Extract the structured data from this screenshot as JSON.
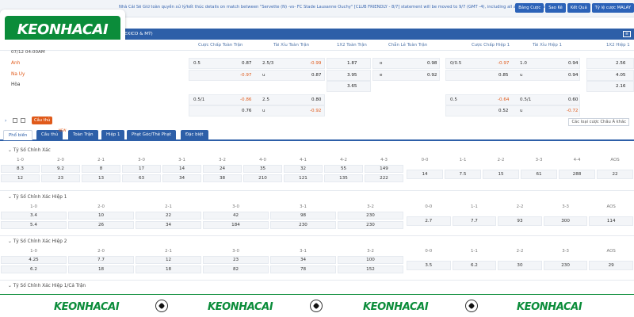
{
  "notice": "Nhà Cái Sẽ Giữ toàn quyền xử lý/kết thúc details on match between \"Servette (N) -vs- FC Stade Lausanne Ouchy\" [CLUB FRIENDLY - 8/7] statement will be moved to 9/7 (GMT -4), including all affected special product.",
  "top_buttons": [
    "Bảng Cược",
    "Sao Kê",
    "Kết Quả",
    "Tỷ lệ cược MALAY"
  ],
  "logo_text": "KEONHACAI",
  "league_name": "(MEXICO & MỸ)",
  "headers": {
    "h1": "Cược Chấp Toàn Trận",
    "h2": "Tài Xỉu Toàn Trận",
    "h3": "1X2 Toàn Trận",
    "h4": "Chẵn Lẻ Toàn Trận",
    "h5": "Cược Chấp Hiệp 1",
    "h6": "Tài Xỉu Hiệp 1",
    "h7": "1X2 Hiệp 1"
  },
  "match": {
    "time": "07/12 04:00AM",
    "home": "Anh",
    "away": "Na Uy",
    "draw": "Hòa"
  },
  "odds": {
    "r1": {
      "hc_line": "0.5",
      "hc_home": "0.87",
      "ou_line": "2.5/3",
      "ou_over": "-0.99",
      "x12_home": "1.87",
      "oe_o": "o",
      "oe_o_val": "0.98",
      "h1hc_line": "0/0.5",
      "h1hc_home": "-0.97",
      "h1ou_line": "1.0",
      "h1ou_over": "0.94",
      "h1x12_home": "2.56"
    },
    "r2": {
      "hc_away": "-0.97",
      "ou_u": "u",
      "ou_under": "0.87",
      "x12_away": "3.95",
      "oe_e": "e",
      "oe_e_val": "0.92",
      "h1hc_away": "0.85",
      "h1ou_u": "u",
      "h1ou_under": "0.94",
      "h1x12_away": "4.05"
    },
    "r3": {
      "x12_draw": "3.65",
      "h1x12_draw": "2.16"
    },
    "r4": {
      "hc_line": "0.5/1",
      "hc_home": "-0.86",
      "ou_line": "2.5",
      "ou_over": "0.80",
      "h1hc_line": "0.5",
      "h1hc_home": "-0.64",
      "h1ou_line": "0.5/1",
      "h1ou_over": "0.60"
    },
    "r5": {
      "hc_away": "0.76",
      "ou_u": "u",
      "ou_under": "-0.92",
      "h1hc_away": "0.52",
      "h1ou_u": "u",
      "h1ou_under": "-0.72"
    }
  },
  "toolbar": {
    "live_badge": "Cầu thủ",
    "sort_label": "Các loại cược Châu Á khác"
  },
  "tabs": [
    "Phổ biến",
    "Cầu thủ",
    "Toàn Trận",
    "Hiệp 1",
    "Phạt Góc/Thẻ Phạt",
    "Đặc biệt"
  ],
  "new_badge": "NEW",
  "sections": [
    {
      "title": "Tỷ Số Chính Xác",
      "labels1": [
        "1-0",
        "2-0",
        "2-1",
        "3-0",
        "3-1",
        "3-2",
        "4-0",
        "4-1",
        "4-2",
        "4-3",
        "0-0",
        "1-1",
        "2-2",
        "3-3",
        "4-4",
        "AOS"
      ],
      "vals1": [
        "8.3",
        "9.2",
        "8",
        "17",
        "14",
        "24",
        "35",
        "32",
        "55",
        "149"
      ],
      "vals2": [
        "12",
        "23",
        "13",
        "63",
        "34",
        "38",
        "210",
        "121",
        "135",
        "222"
      ],
      "draws": [
        "14",
        "7.5",
        "15",
        "61",
        "288",
        "22"
      ]
    },
    {
      "title": "Tỷ Số Chính Xác Hiệp 1",
      "labels1": [
        "1-0",
        "2-0",
        "2-1",
        "3-0",
        "3-1",
        "3-2",
        "0-0",
        "1-1",
        "2-2",
        "3-3",
        "AOS"
      ],
      "vals1": [
        "3.4",
        "10",
        "22",
        "42",
        "98",
        "230"
      ],
      "vals2": [
        "5.4",
        "26",
        "34",
        "184",
        "230",
        "230"
      ],
      "draws": [
        "2.7",
        "7.7",
        "93",
        "300",
        "114"
      ]
    },
    {
      "title": "Tỷ Số Chính Xác Hiệp 2",
      "labels1": [
        "1-0",
        "2-0",
        "2-1",
        "3-0",
        "3-1",
        "3-2",
        "0-0",
        "1-1",
        "2-2",
        "3-3",
        "AOS"
      ],
      "vals1": [
        "4.25",
        "7.7",
        "12",
        "23",
        "34",
        "100"
      ],
      "vals2": [
        "6.2",
        "18",
        "18",
        "82",
        "78",
        "152"
      ],
      "draws": [
        "3.5",
        "6.2",
        "30",
        "230",
        "29"
      ]
    },
    {
      "title": "Tỷ Số Chính Xác Hiệp 1/Cả Trận"
    }
  ],
  "footer_logos": [
    "KEONHACAI",
    "KEONHACAI",
    "KEONHACAI",
    "KEONHACAI"
  ]
}
